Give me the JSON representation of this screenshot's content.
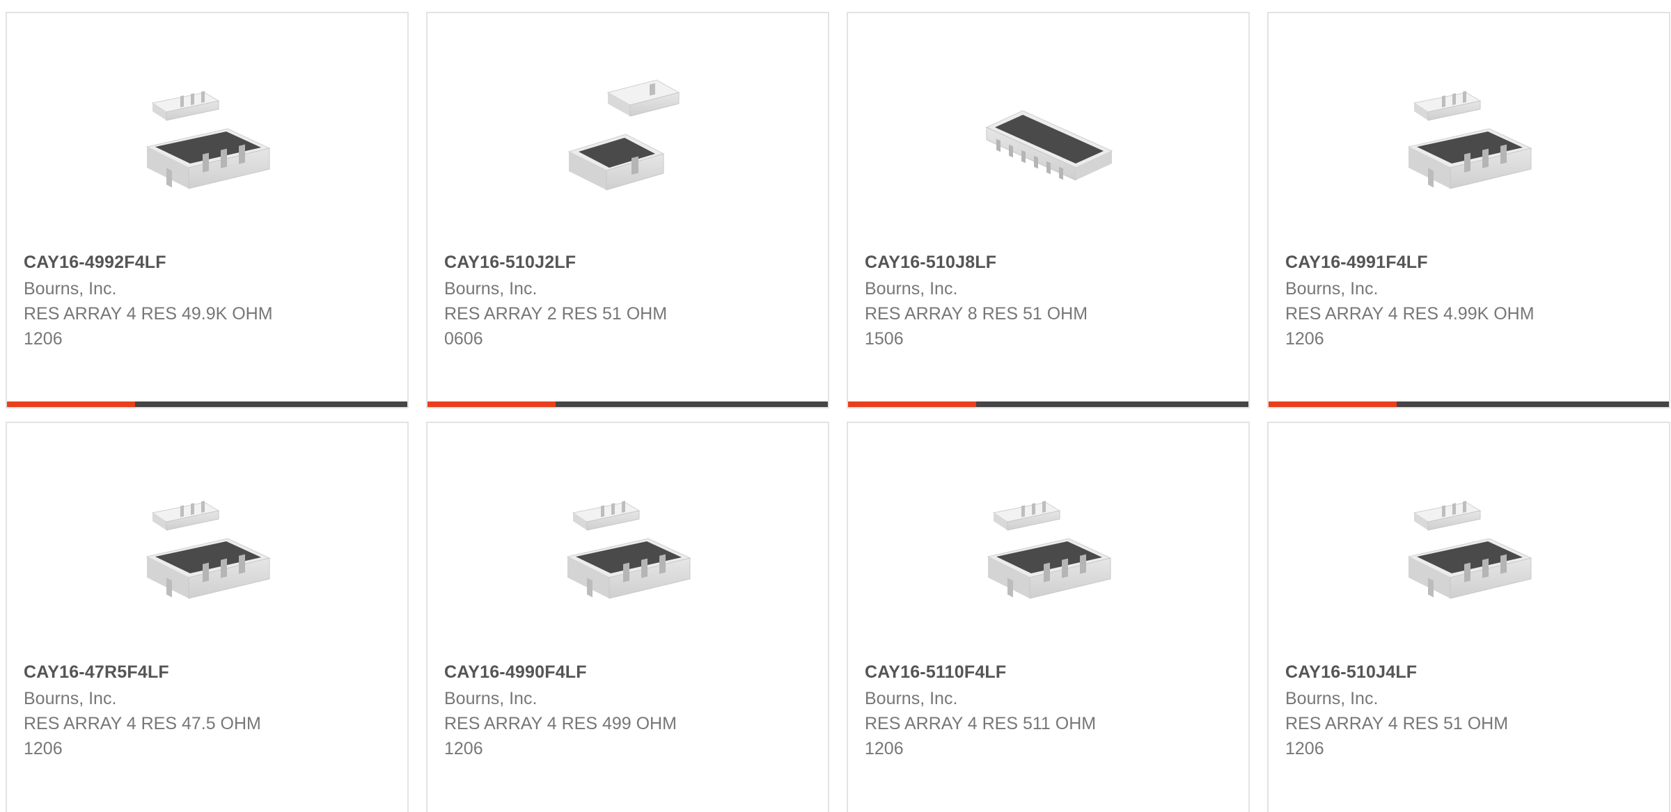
{
  "colors": {
    "accent": "#e8401c",
    "track": "#454545",
    "border": "#e3e3e3",
    "title_text": "#555555",
    "body_text": "#777777"
  },
  "cards": [
    {
      "part_number": "CAY16-4992F4LF",
      "manufacturer": "Bourns, Inc.",
      "description": "RES ARRAY 4 RES 49.9K OHM",
      "package": "1206",
      "image_icon": "resistor-array-4-icon",
      "progress": 0.32
    },
    {
      "part_number": "CAY16-510J2LF",
      "manufacturer": "Bourns, Inc.",
      "description": "RES ARRAY 2 RES 51 OHM",
      "package": "0606",
      "image_icon": "resistor-array-2-icon",
      "progress": 0.32
    },
    {
      "part_number": "CAY16-510J8LF",
      "manufacturer": "Bourns, Inc.",
      "description": "RES ARRAY 8 RES 51 OHM",
      "package": "1506",
      "image_icon": "resistor-array-8-icon",
      "progress": 0.32
    },
    {
      "part_number": "CAY16-4991F4LF",
      "manufacturer": "Bourns, Inc.",
      "description": "RES ARRAY 4 RES 4.99K OHM",
      "package": "1206",
      "image_icon": "resistor-array-4-icon",
      "progress": 0.32
    },
    {
      "part_number": "CAY16-47R5F4LF",
      "manufacturer": "Bourns, Inc.",
      "description": "RES ARRAY 4 RES 47.5 OHM",
      "package": "1206",
      "image_icon": "resistor-array-4-icon"
    },
    {
      "part_number": "CAY16-4990F4LF",
      "manufacturer": "Bourns, Inc.",
      "description": "RES ARRAY 4 RES 499 OHM",
      "package": "1206",
      "image_icon": "resistor-array-4-icon"
    },
    {
      "part_number": "CAY16-5110F4LF",
      "manufacturer": "Bourns, Inc.",
      "description": "RES ARRAY 4 RES 511 OHM",
      "package": "1206",
      "image_icon": "resistor-array-4-icon"
    },
    {
      "part_number": "CAY16-510J4LF",
      "manufacturer": "Bourns, Inc.",
      "description": "RES ARRAY 4 RES 51 OHM",
      "package": "1206",
      "image_icon": "resistor-array-4-icon"
    }
  ]
}
